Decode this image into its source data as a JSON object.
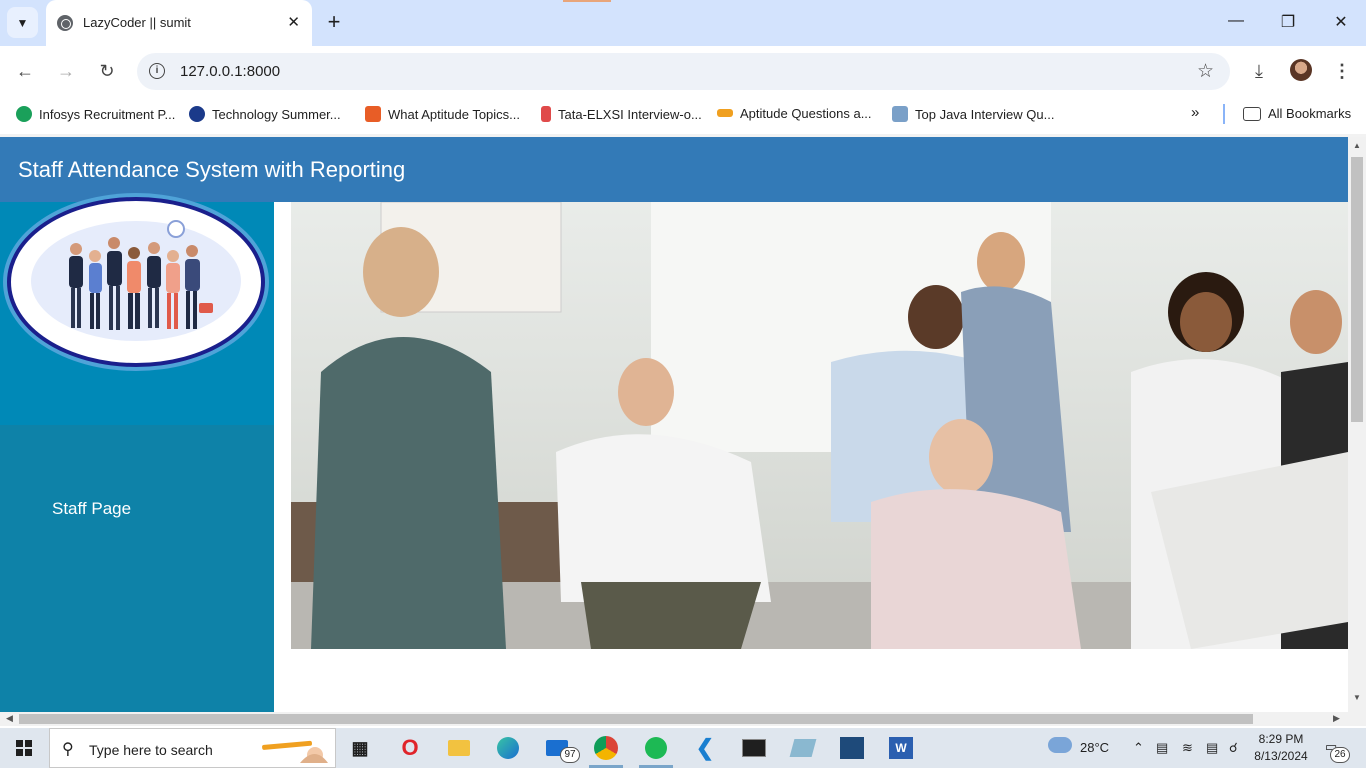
{
  "browser": {
    "tab_title": "LazyCoder || sumit",
    "url": "127.0.0.1:8000",
    "bookmarks": [
      {
        "label": "Infosys Recruitment P...",
        "icon": "infosys-icon",
        "color": "#1aa05a"
      },
      {
        "label": "Technology Summer...",
        "icon": "un-icon",
        "color": "#1b3a8a"
      },
      {
        "label": "What Aptitude Topics...",
        "icon": "cq-icon",
        "color": "#e85d26"
      },
      {
        "label": "Tata-ELXSI Interview-o...",
        "icon": "tata-icon",
        "color": "#e04a4a"
      },
      {
        "label": "Aptitude Questions a...",
        "icon": "aptitude-icon",
        "color": "#f0a020"
      },
      {
        "label": "Top Java Interview Qu...",
        "icon": "java-icon",
        "color": "#7aa0c8"
      }
    ],
    "all_bookmarks_label": "All Bookmarks"
  },
  "page": {
    "header_title": "Staff Attendance System with Reporting",
    "sidebar_link": "Staff Page",
    "header_color": "#337ab7",
    "sidebar_color": "#0e82a8"
  },
  "taskbar": {
    "search_placeholder": "Type here to search",
    "mail_badge": "97",
    "weather": "28°C",
    "time": "8:29 PM",
    "date": "8/13/2024",
    "notification_count": "26"
  }
}
